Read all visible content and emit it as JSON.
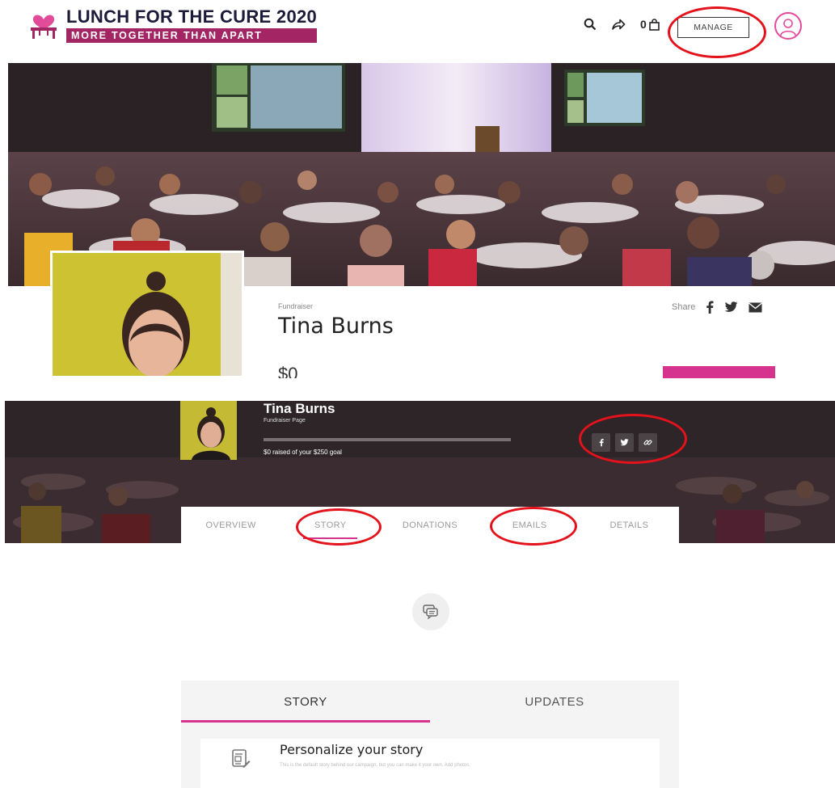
{
  "header": {
    "logo_title": "LUNCH FOR THE CURE 2020",
    "logo_tagline": "MORE TOGETHER THAN APART",
    "cart_count": "0",
    "manage_label": "MANAGE"
  },
  "fundraiser": {
    "label": "Fundraiser",
    "name": "Tina Burns",
    "amount": "$0",
    "share_label": "Share"
  },
  "banner": {
    "name": "Tina Burns",
    "subtitle": "Fundraiser Page",
    "raised_text": "$0 raised of your $250 goal",
    "progress_fraction": 0
  },
  "tabs": [
    {
      "label": "OVERVIEW"
    },
    {
      "label": "STORY"
    },
    {
      "label": "DONATIONS"
    },
    {
      "label": "EMAILS"
    },
    {
      "label": "DETAILS"
    }
  ],
  "sub_tabs": [
    {
      "label": "STORY"
    },
    {
      "label": "UPDATES"
    }
  ],
  "story_card": {
    "title": "Personalize your story",
    "description": "This is the default story behind our campaign, but you can make it your own. Add photos,"
  },
  "colors": {
    "brand_pink": "#d6338f",
    "brand_maroon": "#a32563",
    "annotation_red": "#e3121b"
  }
}
